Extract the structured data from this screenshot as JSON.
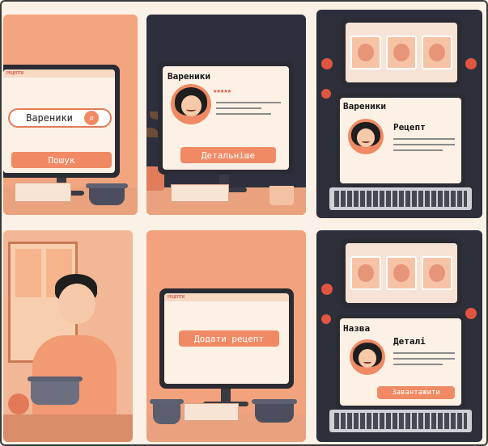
{
  "panel1": {
    "brand": "РЕЦЕПТИ",
    "search_value": "Вареники",
    "search_button": "Пошук"
  },
  "panel2": {
    "title": "Вареники",
    "details_button": "Детальніше"
  },
  "panel3": {
    "title": "Вареники",
    "recipe_label": "Рецепт"
  },
  "panel5": {
    "brand": "РЕЦЕПТИ",
    "add_recipe_button": "Додати рецепт"
  },
  "panel6": {
    "name_label": "Назва",
    "details_label": "Деталі",
    "upload_button": "Завантажити"
  },
  "colors": {
    "accent": "#f08a64",
    "dark": "#2b2b33",
    "screen": "#fdf1e5"
  }
}
